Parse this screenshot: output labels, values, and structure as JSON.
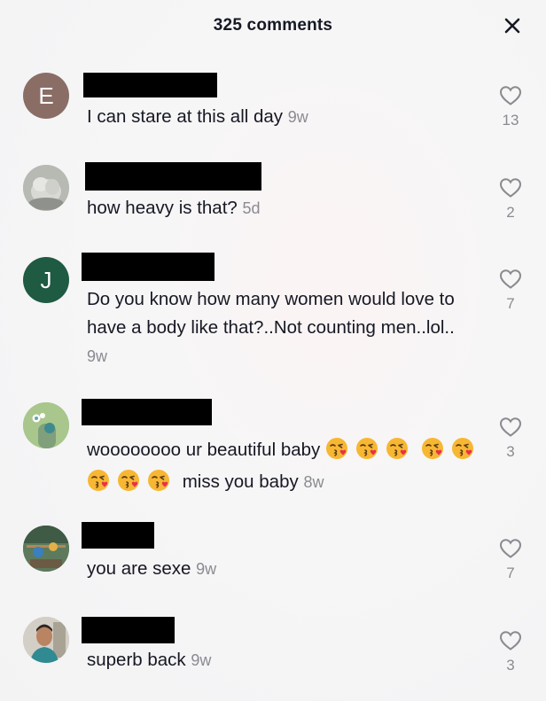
{
  "header": {
    "title": "325 comments"
  },
  "comments": [
    {
      "avatar_letter": "E",
      "avatar_color": "#8a6e66",
      "text": "I can stare at this all day",
      "time": "9w",
      "likes": "13"
    },
    {
      "avatar_letter": "",
      "text": "how heavy is that?",
      "time": "5d",
      "likes": "2"
    },
    {
      "avatar_letter": "J",
      "avatar_color": "#1f5a43",
      "text": "Do you know how many women would love to have a body like that?..Not counting men..lol..",
      "time": "9w",
      "likes": "7"
    },
    {
      "avatar_letter": "",
      "text_part1": "woooooooo ur beautiful baby",
      "text_part2": "miss you baby",
      "emoji_name": "face-blowing-a-kiss",
      "time": "8w",
      "likes": "3"
    },
    {
      "avatar_letter": "",
      "text": "you are sexe",
      "time": "9w",
      "likes": "7"
    },
    {
      "avatar_letter": "",
      "text": "superb back",
      "time": "9w",
      "likes": "3"
    }
  ]
}
